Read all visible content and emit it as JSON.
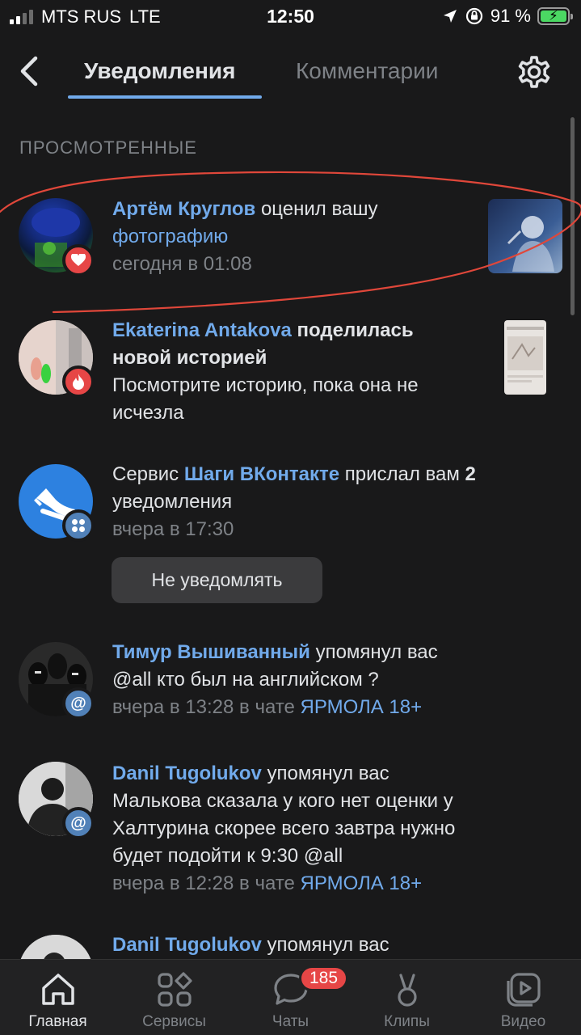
{
  "status_bar": {
    "carrier": "MTS RUS",
    "network": "LTE",
    "time": "12:50",
    "battery": "91 %",
    "icons": [
      "signal-icon",
      "location-icon",
      "orientation-lock-icon",
      "battery-charging-icon"
    ]
  },
  "header": {
    "back_icon": "chevron-left-icon",
    "tabs": [
      {
        "label": "Уведомления",
        "active": true
      },
      {
        "label": "Комментарии",
        "active": false
      }
    ],
    "settings_icon": "gear-icon"
  },
  "section": {
    "title": "ПРОСМОТРЕННЫЕ"
  },
  "notifications": [
    {
      "author": "Артём Круглов",
      "action": " оценил вашу",
      "object": "фотографию",
      "time": "сегодня в 01:08",
      "badge_icon": "heart-icon",
      "badge_color": "#e64646"
    },
    {
      "author": "Ekaterina Antakova",
      "action": " поделилась",
      "action_line2": "новой историей",
      "body_line1": "Посмотрите историю, пока она не",
      "body_line2": "исчезла",
      "badge_icon": "fire-icon",
      "badge_color": "#e64646"
    },
    {
      "prefix": "Сервис ",
      "service": "Шаги ВКонтакте",
      "action": " прислал вам ",
      "count": "2",
      "line2": "уведомления",
      "time": "вчера в 17:30",
      "badge_icon": "services-grid-icon",
      "badge_color": "#5181b8",
      "button_label": "Не уведомлять"
    },
    {
      "author": "Тимур Вышиванный",
      "action": " упомянул вас",
      "message": "@all кто был на английском ?",
      "time": "вчера в 13:28 в чате ",
      "chat": "ЯРМОЛА 18+",
      "badge_icon": "at-icon",
      "badge_color": "#5181b8"
    },
    {
      "author": "Danil Tugolukov",
      "action": " упомянул вас",
      "message_line1": "Малькова сказала у кого нет оценки у",
      "message_line2": "Халтурина скорее всего завтра нужно",
      "message_line3": "будет подойти к 9:30 @all",
      "time": "вчера в 12:28 в чате ",
      "chat": "ЯРМОЛА 18+",
      "badge_icon": "at-icon",
      "badge_color": "#5181b8"
    },
    {
      "author": "Danil Tugolukov",
      "action": " упомянул вас"
    }
  ],
  "bottom_nav": [
    {
      "label": "Главная",
      "icon": "home-icon",
      "active": true
    },
    {
      "label": "Сервисы",
      "icon": "services-icon",
      "active": false
    },
    {
      "label": "Чаты",
      "icon": "chat-icon",
      "active": false,
      "badge": "185"
    },
    {
      "label": "Клипы",
      "icon": "clips-icon",
      "active": false
    },
    {
      "label": "Видео",
      "icon": "video-icon",
      "active": false
    }
  ],
  "colors": {
    "background": "#19191a",
    "link": "#71aaeb",
    "secondary_text": "#7e8287",
    "badge_red": "#e64646",
    "badge_blue": "#5181b8",
    "annotation_red": "#e0473a"
  }
}
